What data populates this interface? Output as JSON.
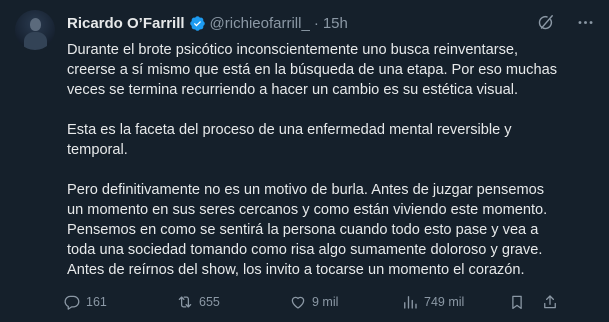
{
  "author": {
    "name": "Ricardo O’Farrill",
    "handle": "@richieofarrill_",
    "separator": "·",
    "time": "15h",
    "verified_color": "#1d9bf0"
  },
  "body": {
    "paragraphs": [
      [
        "Durante el brote psicótico inconscientemente uno busca reinventarse,",
        "creerse a sí mismo que está en la búsqueda de una etapa. Por eso muchas",
        "veces se termina recurriendo a hacer un cambio es su estética visual."
      ],
      [
        "Esta es la faceta del proceso de una enfermedad mental reversible y",
        "temporal."
      ],
      [
        "Pero definitivamente no es un motivo de burla. Antes de juzgar pensemos",
        "un momento en sus seres cercanos y como están viviendo este momento.",
        "Pensemos en como se sentirá la persona cuando todo esto pase y vea a",
        "toda una sociedad tomando como risa algo sumamente doloroso y grave.",
        "Antes de reírnos del show, los invito a tocarse un momento el corazón."
      ]
    ]
  },
  "metrics": {
    "replies": "161",
    "retweets": "655",
    "likes": "9 mil",
    "views": "749 mil"
  },
  "icons": {
    "grok": "grok-icon",
    "more": "more-icon",
    "reply": "reply-icon",
    "retweet": "retweet-icon",
    "like": "heart-icon",
    "views": "views-icon",
    "bookmark": "bookmark-icon",
    "share": "share-icon"
  },
  "colors": {
    "background": "#15202b",
    "text": "#e7e9ea",
    "secondary": "#8b98a5"
  }
}
